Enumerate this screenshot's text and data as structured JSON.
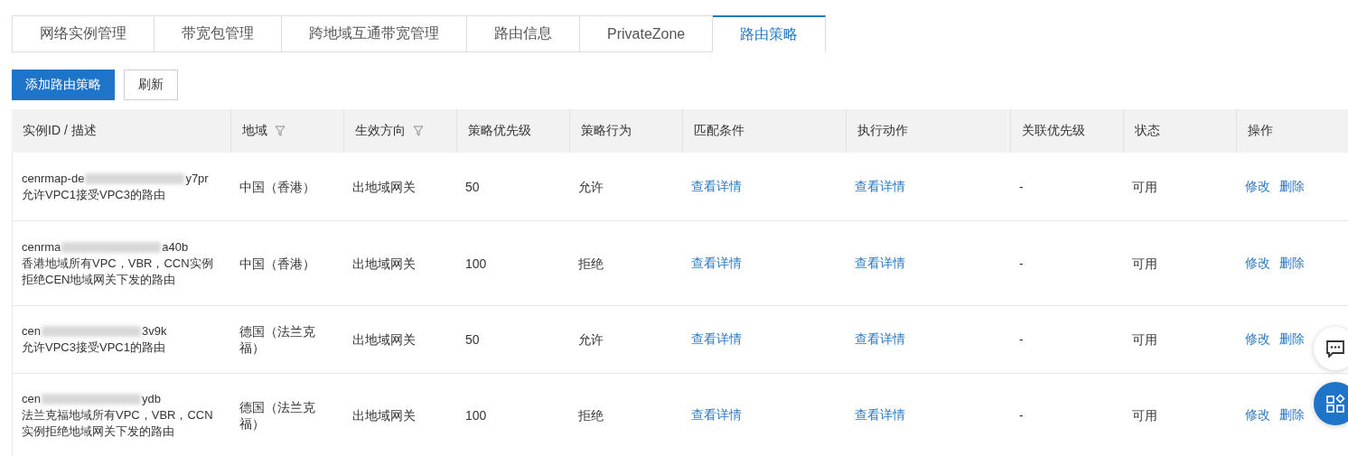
{
  "tabs": [
    {
      "label": "网络实例管理",
      "selected": false
    },
    {
      "label": "带宽包管理",
      "selected": false
    },
    {
      "label": "跨地域互通带宽管理",
      "selected": false
    },
    {
      "label": "路由信息",
      "selected": false
    },
    {
      "label": "PrivateZone",
      "selected": false
    },
    {
      "label": "路由策略",
      "selected": true
    }
  ],
  "toolbar": {
    "primary_button": "添加路由策略",
    "refresh_button": "刷新"
  },
  "table": {
    "columns": [
      {
        "label": "实例ID / 描述",
        "filter": false
      },
      {
        "label": "地域",
        "filter": true
      },
      {
        "label": "生效方向",
        "filter": true
      },
      {
        "label": "策略优先级",
        "filter": false
      },
      {
        "label": "策略行为",
        "filter": false
      },
      {
        "label": "匹配条件",
        "filter": false
      },
      {
        "label": "执行动作",
        "filter": false
      },
      {
        "label": "关联优先级",
        "filter": false
      },
      {
        "label": "状态",
        "filter": false
      },
      {
        "label": "操作",
        "filter": false
      }
    ],
    "rows": [
      {
        "id_start": "cenrmap-de",
        "id_end": "y7pr",
        "description": "允许VPC1接受VPC3的路由",
        "region": "中国（香港）",
        "direction": "出地域网关",
        "priority": "50",
        "action": "允许",
        "match": "查看详情",
        "execute": "查看详情",
        "linked_priority": "-",
        "status": "可用",
        "edit": "修改",
        "delete": "删除"
      },
      {
        "id_start": "cenrma",
        "id_end": "a40b",
        "description": "香港地域所有VPC，VBR，CCN实例拒绝CEN地域网关下发的路由",
        "region": "中国（香港）",
        "direction": "出地域网关",
        "priority": "100",
        "action": "拒绝",
        "match": "查看详情",
        "execute": "查看详情",
        "linked_priority": "-",
        "status": "可用",
        "edit": "修改",
        "delete": "删除"
      },
      {
        "id_start": "cen",
        "id_end": "3v9k",
        "description": "允许VPC3接受VPC1的路由",
        "region": "德国（法兰克福）",
        "direction": "出地域网关",
        "priority": "50",
        "action": "允许",
        "match": "查看详情",
        "execute": "查看详情",
        "linked_priority": "-",
        "status": "可用",
        "edit": "修改",
        "delete": "删除"
      },
      {
        "id_start": "cen",
        "id_end": "ydb",
        "description": "法兰克福地域所有VPC，VBR，CCN实例拒绝地域网关下发的路由",
        "region": "德国（法兰克福）",
        "direction": "出地域网关",
        "priority": "100",
        "action": "拒绝",
        "match": "查看详情",
        "execute": "查看详情",
        "linked_priority": "-",
        "status": "可用",
        "edit": "修改",
        "delete": "删除"
      }
    ]
  }
}
